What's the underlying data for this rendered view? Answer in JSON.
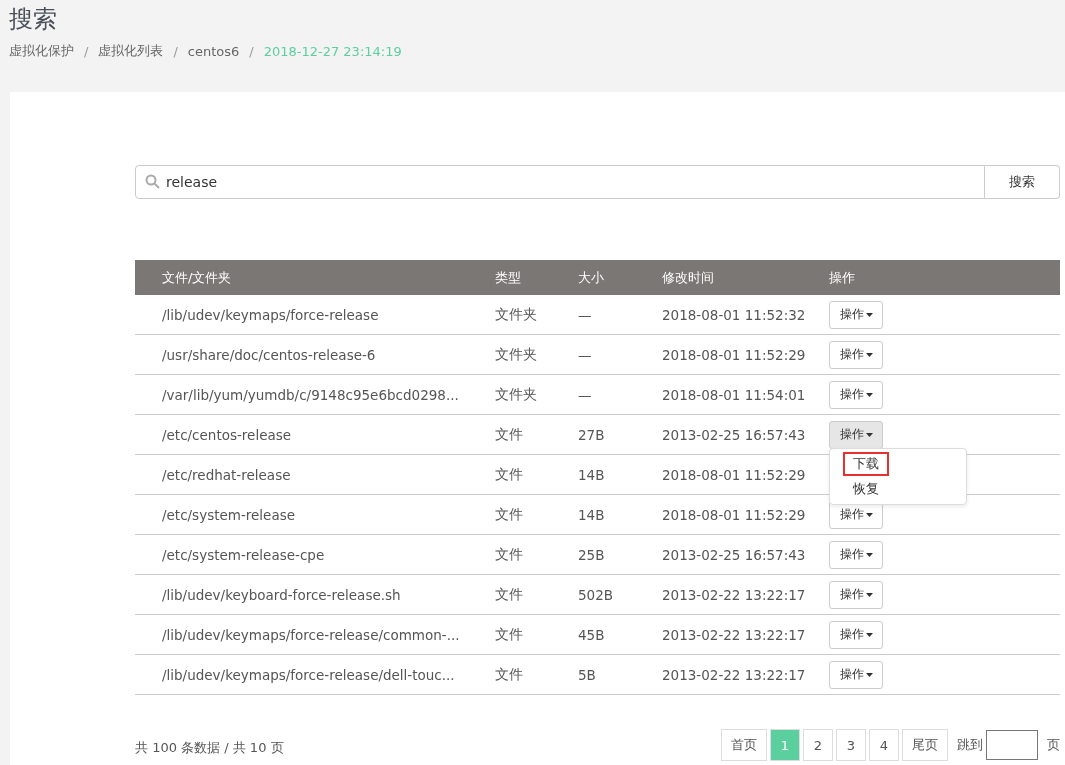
{
  "page_title": "搜索",
  "breadcrumb": [
    {
      "label": "虚拟化保护",
      "current": false
    },
    {
      "label": "虚拟化列表",
      "current": false
    },
    {
      "label": "centos6",
      "current": false
    },
    {
      "label": "2018-12-27 23:14:19",
      "current": true
    }
  ],
  "breadcrumb_separator": "/",
  "search": {
    "value": "release",
    "button": "搜索"
  },
  "table": {
    "columns": [
      "文件/文件夹",
      "类型",
      "大小",
      "修改时间",
      "操作"
    ],
    "rows": [
      {
        "path": "/lib/udev/keymaps/force-release",
        "type": "文件夹",
        "size": "—",
        "modified": "2018-08-01 11:52:32",
        "action": "操作"
      },
      {
        "path": "/usr/share/doc/centos-release-6",
        "type": "文件夹",
        "size": "—",
        "modified": "2018-08-01 11:52:29",
        "action": "操作"
      },
      {
        "path": "/var/lib/yum/yumdb/c/9148c95e6bcd0298...",
        "type": "文件夹",
        "size": "—",
        "modified": "2018-08-01 11:54:01",
        "action": "操作"
      },
      {
        "path": "/etc/centos-release",
        "type": "文件",
        "size": "27B",
        "modified": "2013-02-25 16:57:43",
        "action": "操作",
        "open": true,
        "menu": [
          {
            "label": "下载",
            "marked": true
          },
          {
            "label": "恢复",
            "marked": false
          }
        ]
      },
      {
        "path": "/etc/redhat-release",
        "type": "文件",
        "size": "14B",
        "modified": "2018-08-01 11:52:29"
      },
      {
        "path": "/etc/system-release",
        "type": "文件",
        "size": "14B",
        "modified": "2018-08-01 11:52:29",
        "action": "操作"
      },
      {
        "path": "/etc/system-release-cpe",
        "type": "文件",
        "size": "25B",
        "modified": "2013-02-25 16:57:43",
        "action": "操作"
      },
      {
        "path": "/lib/udev/keyboard-force-release.sh",
        "type": "文件",
        "size": "502B",
        "modified": "2013-02-22 13:22:17",
        "action": "操作"
      },
      {
        "path": "/lib/udev/keymaps/force-release/common-...",
        "type": "文件",
        "size": "45B",
        "modified": "2013-02-22 13:22:17",
        "action": "操作"
      },
      {
        "path": "/lib/udev/keymaps/force-release/dell-touc...",
        "type": "文件",
        "size": "5B",
        "modified": "2013-02-22 13:22:17",
        "action": "操作"
      }
    ]
  },
  "summary": "共 100 条数据 / 共 10 页",
  "pagination": {
    "pages": [
      {
        "label": "首页",
        "selected": false
      },
      {
        "label": "1",
        "selected": true
      },
      {
        "label": "2",
        "selected": false
      },
      {
        "label": "3",
        "selected": false
      },
      {
        "label": "4",
        "selected": false
      },
      {
        "label": "尾页",
        "selected": false
      }
    ],
    "jump_label": "跳到",
    "jump_suffix": "页"
  }
}
